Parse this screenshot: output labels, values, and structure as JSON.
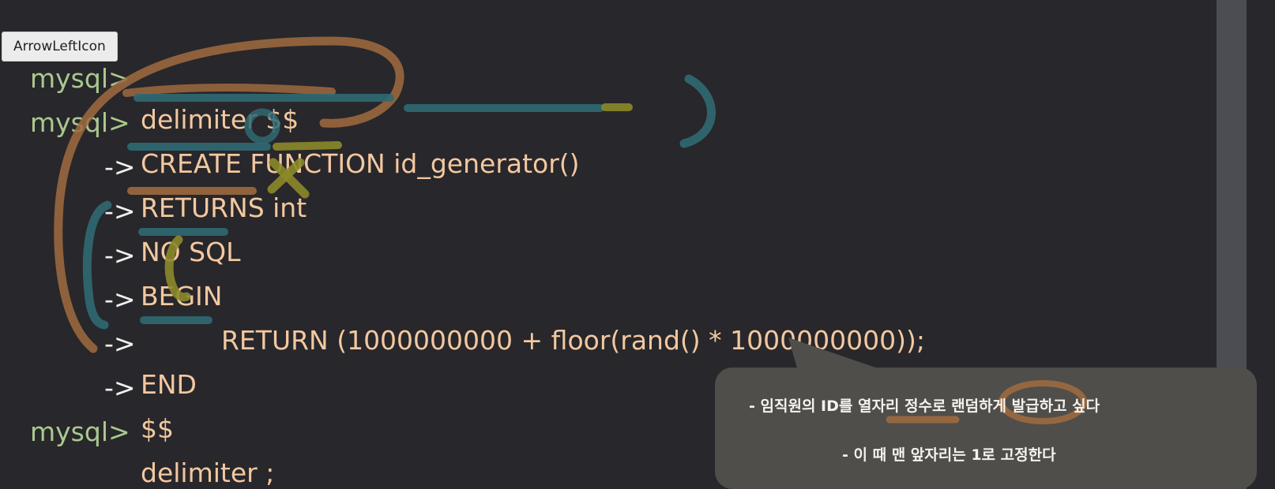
{
  "tooltip": {
    "label": "ArrowLeftIcon"
  },
  "code": {
    "lines": [
      {
        "prompt": "mysql>",
        "arrow": "",
        "text": "delimiter $$"
      },
      {
        "prompt": "mysql>",
        "arrow": "",
        "text": "CREATE FUNCTION id_generator()"
      },
      {
        "prompt": "",
        "arrow": "->",
        "text": "RETURNS int"
      },
      {
        "prompt": "",
        "arrow": "->",
        "text": "NO SQL"
      },
      {
        "prompt": "",
        "arrow": "->",
        "text": "BEGIN"
      },
      {
        "prompt": "",
        "arrow": "->",
        "text": "RETURN (1000000000 + floor(rand() * 1000000000));"
      },
      {
        "prompt": "",
        "arrow": "->",
        "text": "END"
      },
      {
        "prompt": "",
        "arrow": "->",
        "text": "$$"
      },
      {
        "prompt": "mysql>",
        "arrow": "",
        "text": "delimiter ;"
      }
    ]
  },
  "note": {
    "line1": "- 임직원의 ID를 열자리 정수로 랜덤하게 발급하고 싶다",
    "line2": "- 이 때 맨 앞자리는 1로 고정한다"
  },
  "colors": {
    "background": "#28272b",
    "prompt": "#a9c98f",
    "keyword": "#f3c8a0",
    "arrow": "#f2f0ec",
    "annotation_brown": "#9c6a3f",
    "annotation_teal": "#2f6a73",
    "annotation_olive": "#8c8a2a",
    "bubble": "#4f4e4a",
    "scrollbar": "#4b4d52"
  }
}
